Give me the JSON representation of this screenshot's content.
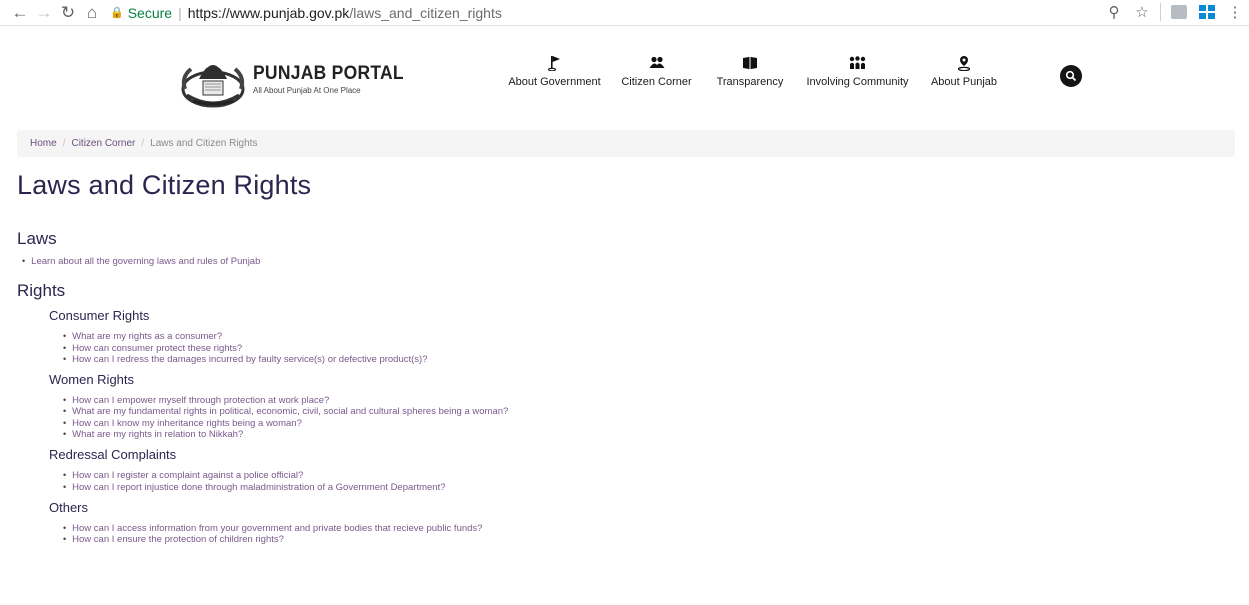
{
  "browser": {
    "secure_label": "Secure",
    "url_host": "https://www.punjab.gov.pk",
    "url_path": "/laws_and_citizen_rights"
  },
  "header": {
    "logo_title": "PUNJAB PORTAL",
    "logo_subtitle": "All About Punjab At One Place",
    "nav": [
      {
        "label": "About Government",
        "icon": "flag-icon"
      },
      {
        "label": "Citizen Corner",
        "icon": "people-icon"
      },
      {
        "label": "Transparency",
        "icon": "book-icon"
      },
      {
        "label": "Involving Community",
        "icon": "community-icon"
      },
      {
        "label": "About Punjab",
        "icon": "location-pin-icon"
      }
    ],
    "search_icon": "search-icon"
  },
  "breadcrumb": {
    "home": "Home",
    "parent": "Citizen Corner",
    "current": "Laws and Citizen Rights"
  },
  "page": {
    "title": "Laws and Citizen Rights",
    "laws": {
      "heading": "Laws",
      "items": [
        "Learn about all the governing laws and rules of Punjab"
      ]
    },
    "rights": {
      "heading": "Rights",
      "consumer": {
        "heading": "Consumer Rights",
        "items": [
          "What are my rights as a consumer?",
          "How can consumer protect these rights?",
          "How can I redress the damages incurred by faulty service(s) or defective product(s)?"
        ]
      },
      "women": {
        "heading": "Women Rights",
        "items": [
          "How can I empower myself through protection at work place?",
          "What are my fundamental rights in political, economic, civil, social and cultural spheres being a woman?",
          "How can I know my inheritance rights being a woman?",
          "What are my rights in relation to Nikkah?"
        ]
      },
      "redressal": {
        "heading": "Redressal Complaints",
        "items": [
          "How can I register a complaint against a police official?",
          "How can I report injustice done through maladministration of a Government Department?"
        ]
      },
      "others": {
        "heading": "Others",
        "items": [
          "How can I access information from your government and private bodies that recieve public funds?",
          "How can I ensure the protection of children rights?"
        ]
      }
    }
  }
}
